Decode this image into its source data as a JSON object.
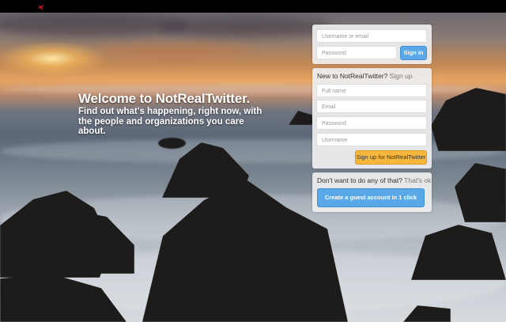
{
  "header": {
    "logo_icon": "bird-icon",
    "logo_color": "#c8102e"
  },
  "welcome": {
    "title": "Welcome to NotRealTwitter.",
    "subtitle": "Find out what's happening, right now, with the people and organizations you care about."
  },
  "signin": {
    "username_placeholder": "Username or email",
    "password_placeholder": "Password",
    "button": "Sign in"
  },
  "signup": {
    "heading": "New to NotRealTwitter?",
    "heading_link": "Sign up",
    "fullname_placeholder": "Full name",
    "email_placeholder": "Email",
    "password_placeholder": "Password",
    "username_placeholder": "Username",
    "button": "Sign up for NotRealTwitter"
  },
  "guest": {
    "heading": "Don't want to do any of that?",
    "heading_link": "That's ok",
    "button": "Create a guest account in 1 click"
  },
  "colors": {
    "accent_blue": "#5aa8e8",
    "signup_yellow": "#f6b73c",
    "topbar": "#000000"
  }
}
